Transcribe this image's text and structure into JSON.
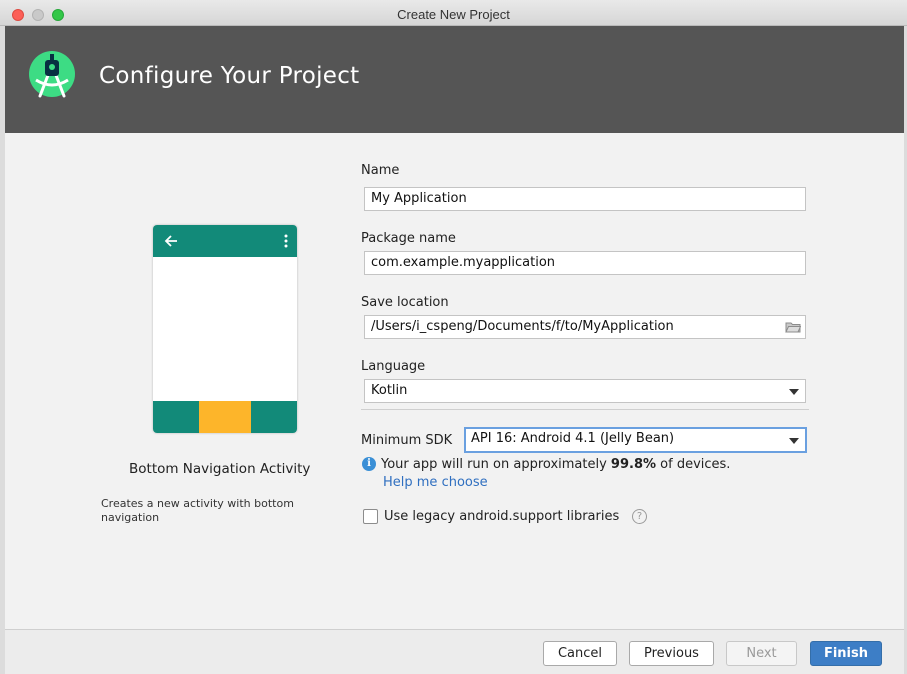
{
  "window": {
    "title": "Create New Project"
  },
  "header": {
    "title": "Configure Your Project",
    "logo_icon": "android-studio-logo-icon"
  },
  "preview": {
    "activity_name": "Bottom Navigation Activity",
    "activity_description": "Creates a new activity with bottom navigation",
    "appbar_color": "#128a79",
    "accent_color": "#fdb52a"
  },
  "form": {
    "name": {
      "label": "Name",
      "value": "My Application"
    },
    "package": {
      "label": "Package name",
      "value": "com.example.myapplication"
    },
    "save_location": {
      "label": "Save location",
      "value": "/Users/i_cspeng/Documents/f/to/MyApplication"
    },
    "language": {
      "label": "Language",
      "value": "Kotlin"
    },
    "min_sdk": {
      "label": "Minimum SDK",
      "value": "API 16: Android 4.1 (Jelly Bean)"
    },
    "info": {
      "prefix": "Your app will run on approximately ",
      "percent": "99.8%",
      "suffix": " of devices."
    },
    "help_link": "Help me choose",
    "legacy_checkbox": {
      "label": "Use legacy android.support libraries",
      "checked": false
    }
  },
  "footer": {
    "cancel": "Cancel",
    "previous": "Previous",
    "next": "Next",
    "finish": "Finish"
  },
  "colors": {
    "header_bg": "#555555",
    "primary_button": "#3d7ec6",
    "link": "#2f6fc0"
  }
}
